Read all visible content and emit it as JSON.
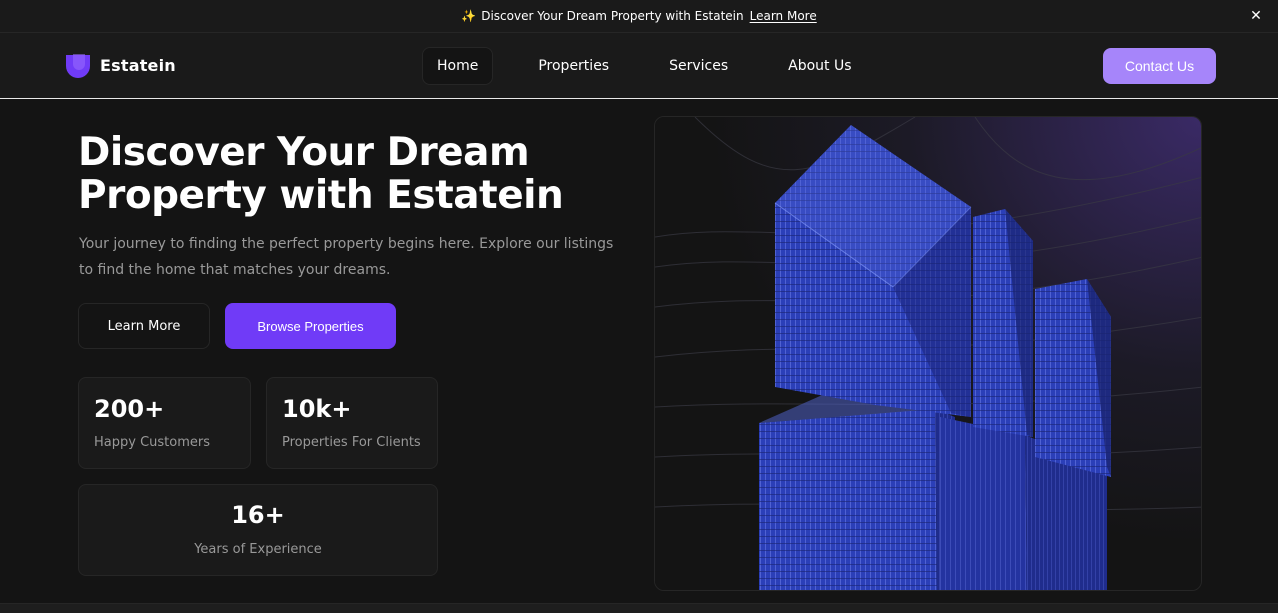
{
  "banner": {
    "icon": "sparkles-icon",
    "text": "Discover Your Dream Property with Estatein",
    "link_label": "Learn More",
    "close_icon": "close-icon"
  },
  "nav": {
    "brand": "Estatein",
    "items": [
      {
        "label": "Home",
        "active": true
      },
      {
        "label": "Properties",
        "active": false
      },
      {
        "label": "Services",
        "active": false
      },
      {
        "label": "About Us",
        "active": false
      }
    ],
    "contact_label": "Contact Us"
  },
  "hero": {
    "title": "Discover Your Dream Property with Estatein",
    "description": "Your journey to finding the perfect property begins here. Explore our listings to find the home that matches your dreams.",
    "learn_more_label": "Learn More",
    "browse_label": "Browse Properties",
    "stats": [
      {
        "value": "200+",
        "label": "Happy Customers"
      },
      {
        "value": "10k+",
        "label": "Properties For Clients"
      },
      {
        "value": "16+",
        "label": "Years of Experience"
      }
    ]
  },
  "colors": {
    "accent": "#703bf7",
    "accent_light": "#a685fa",
    "background": "#141414",
    "surface": "#1a1a1a",
    "muted_text": "#999999"
  }
}
